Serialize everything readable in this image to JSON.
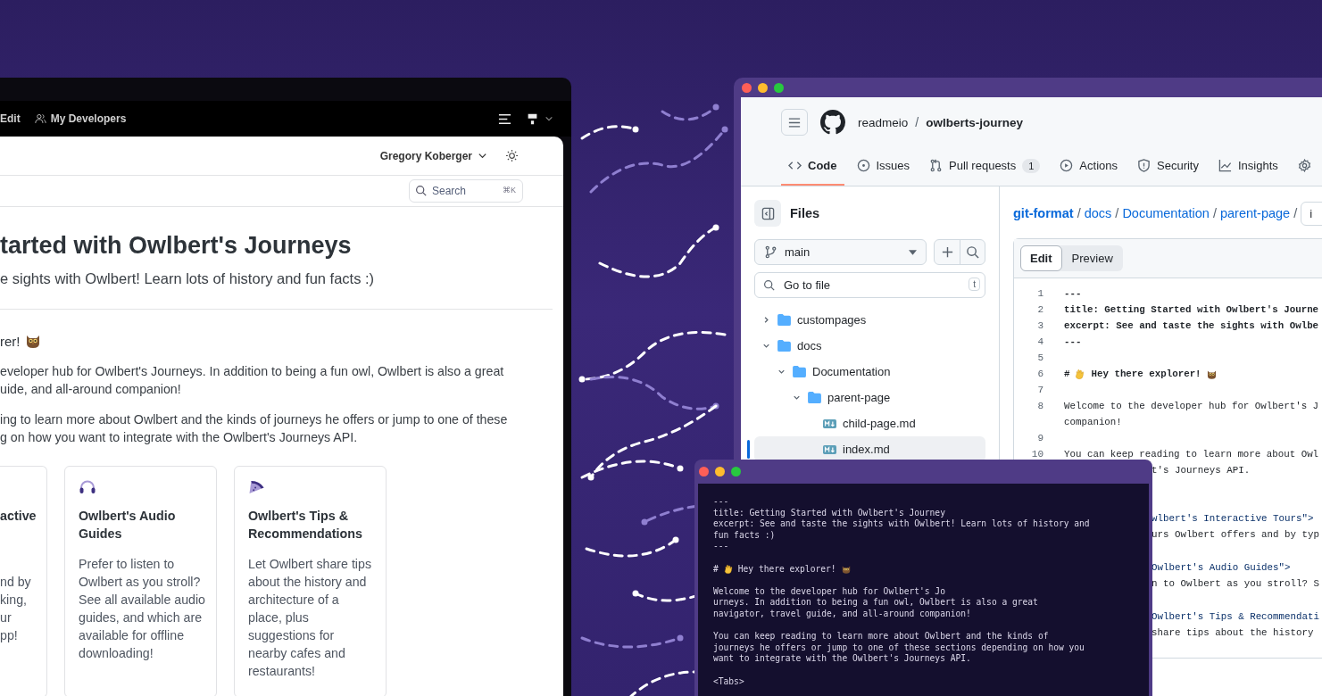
{
  "left_window": {
    "toolbar": [
      {
        "label": "Edit",
        "kind": "text"
      },
      {
        "label": "My Developers",
        "kind": "people"
      }
    ],
    "user_menu": "Gregory Koberger",
    "search": {
      "placeholder": "Search",
      "shortcut": "⌘K"
    },
    "page_title": "tarted with Owlbert's Journeys",
    "page_subtitle": "e sights with Owlbert! Learn lots of history and fun facts :)",
    "heading": "rer!",
    "paragraphs": [
      [
        "eveloper hub for Owlbert's Journeys. In addition to being a fun owl, Owlbert is also a great",
        "uide, and all-around companion!"
      ],
      [
        "ing to learn more about Owlbert and the kinds of journeys he offers or jump to one of these",
        "g on how you want to integrate with the Owlbert's Journeys API."
      ]
    ],
    "cards": [
      {
        "kind": "clipped",
        "title": [
          "active"
        ],
        "body": [
          "nd by",
          "king,",
          "ur",
          "pp!"
        ]
      },
      {
        "kind": "headphones",
        "title": [
          "Owlbert's Audio",
          "Guides"
        ],
        "body": [
          "Prefer to listen to",
          "Owlbert as you stroll?",
          "See all available audio",
          "guides, and which are",
          "available for offline",
          "downloading!"
        ]
      },
      {
        "kind": "slice",
        "title": [
          "Owlbert's Tips &",
          "Recommendations"
        ],
        "body": [
          "Let Owlbert share tips",
          "about the history and",
          "architecture of a",
          "place, plus",
          "suggestions for",
          "nearby cafes and",
          "restaurants!"
        ]
      }
    ]
  },
  "github_window": {
    "owner": "readmeio",
    "repo_separator": "/",
    "repo": "owlberts-journey",
    "tabs": [
      {
        "label": "Code",
        "kind": "code",
        "selected": true
      },
      {
        "label": "Issues",
        "kind": "issue",
        "selected": false
      },
      {
        "label": "Pull requests",
        "kind": "pr",
        "count": "1",
        "selected": false
      },
      {
        "label": "Actions",
        "kind": "play",
        "selected": false
      },
      {
        "label": "Security",
        "kind": "shield",
        "selected": false
      },
      {
        "label": "Insights",
        "kind": "graph",
        "selected": false
      },
      {
        "kind": "gear",
        "selected": false
      }
    ],
    "files": {
      "title": "Files",
      "branch": "main",
      "search_placeholder": "Go to file",
      "shortcut": "t",
      "tree": [
        {
          "name": "custompages",
          "kind": "folder",
          "expanded": false,
          "selected": false
        },
        {
          "name": "docs",
          "kind": "folder",
          "expanded": true,
          "selected": false,
          "children": [
            {
              "name": "Documentation",
              "kind": "folder",
              "expanded": true,
              "selected": false,
              "children": [
                {
                  "name": "parent-page",
                  "kind": "folder",
                  "expanded": true,
                  "selected": false,
                  "children": [
                    {
                      "name": "child-page.md",
                      "kind": "file",
                      "selected": false
                    },
                    {
                      "name": "index.md",
                      "kind": "file",
                      "selected": true
                    }
                  ]
                }
              ]
            }
          ]
        }
      ]
    },
    "breadcrumb": [
      {
        "label": "git-format",
        "separator": "/"
      },
      {
        "label": "docs",
        "separator": "/"
      },
      {
        "label": "Documentation",
        "separator": "/"
      },
      {
        "label": "parent-page",
        "separator": "/"
      }
    ],
    "filename_field": "i",
    "editor_tabs": [
      {
        "label": "Edit",
        "selected": true
      },
      {
        "label": "Preview",
        "selected": false
      }
    ],
    "code_lines": [
      {
        "number": "1",
        "text": "---",
        "bold": true
      },
      {
        "number": "2",
        "text": "title: Getting Started with Owlbert's Journe",
        "bold": true
      },
      {
        "number": "3",
        "text": "excerpt: See and taste the sights with Owlbe",
        "bold": true
      },
      {
        "number": "4",
        "text": "---",
        "bold": true
      },
      {
        "number": "5"
      },
      {
        "number": "6",
        "prefix": "#",
        "text": "Hey there explorer!",
        "kind": "heading",
        "bold": true
      },
      {
        "number": "7"
      },
      {
        "number": "8",
        "text": "Welcome to the developer hub for Owlbert's J",
        "bold": false
      },
      {
        "text": "companion!",
        "bold": false
      },
      {
        "number": "9"
      },
      {
        "number": "10",
        "text": "You can keep reading to learn more about Owl",
        "bold": false
      }
    ],
    "hidden_tails": [
      [
        {
          "text": "t's Journeys API.",
          "kind": "text"
        }
      ],
      [
        {
          "text": "wlbert's Interactive Tours\">",
          "kind": "attr"
        },
        {
          "text": "urs Owlbert offers and by typ",
          "kind": "text"
        }
      ],
      [
        {
          "text": "Owlbert's Audio Guides\">",
          "kind": "attr"
        },
        {
          "text": "n to Owlbert as you stroll? S",
          "kind": "text"
        }
      ],
      [
        {
          "text": "Owlbert's Tips & Recommendati",
          "kind": "attr"
        },
        {
          "text": " share tips about the history",
          "kind": "text"
        }
      ]
    ]
  },
  "terminal_window": {
    "lines": [
      {
        "text": "---"
      },
      {
        "text": "title: Getting Started with Owlbert's Journey"
      },
      {
        "text": "excerpt: See and taste the sights with Owlbert! Learn lots of history and"
      },
      {
        "text": "fun facts :)"
      },
      {
        "text": "---"
      },
      {
        "prefix": "#",
        "text": "Hey there explorer!",
        "kind": "heading",
        "gap_before": true
      },
      {
        "text": "Welcome to the developer hub for Owlbert's Jo",
        "gap_before": true
      },
      {
        "text": "urneys. In addition to being a fun owl, Owlbert is also a great"
      },
      {
        "text": "navigator, travel guide, and all-around companion!"
      },
      {
        "text": "You can keep reading to learn more about Owlbert and the kinds of",
        "gap_before": true
      },
      {
        "text": "journeys he offers or jump to one of these sections depending on how you"
      },
      {
        "text": "want to integrate with the Owlbert's Journeys API."
      },
      {
        "text": "<Tabs>",
        "gap_before": true
      }
    ]
  }
}
